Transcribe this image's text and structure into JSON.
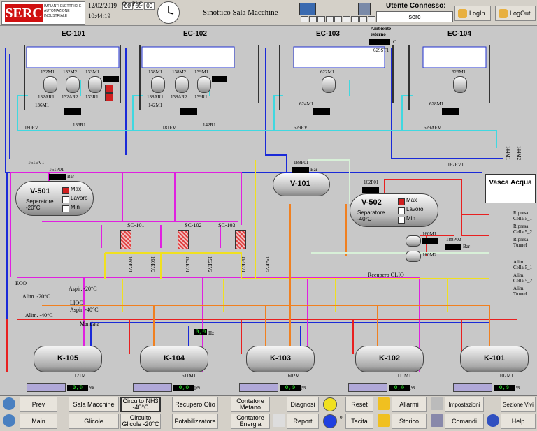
{
  "header": {
    "logo_text": "SERC",
    "logo_sub": "IMPIANTI ELETTRICI E AUTOMAZIONE INDUSTRIALE",
    "date": "12/02/2019",
    "time": "10:44:19",
    "plc_label": "Ora PLC",
    "plc_time": [
      "00",
      "00",
      "00"
    ],
    "title": "Sinottico Sala Macchine",
    "user_label": "Utente Connesso:",
    "user_value": "serc",
    "login_label": "LogIn",
    "logout_label": "LogOut"
  },
  "evaporators": [
    {
      "name": "EC-101",
      "motors": [
        "132M1",
        "132M2",
        "133M1"
      ],
      "ar": [
        "132AR1",
        "132AR2",
        "133R1"
      ],
      "fan": "136M1",
      "valve": "180EV",
      "r": "136R1"
    },
    {
      "name": "EC-102",
      "motors": [
        "138M1",
        "138M2",
        "139M1"
      ],
      "ar": [
        "138AR1",
        "138AR2",
        "139R1"
      ],
      "fan": "142M1",
      "valve": "181EV",
      "r": "142R1"
    },
    {
      "name": "EC-103",
      "motors": [
        "622M1"
      ],
      "fan": "624M1",
      "valve": "629EV"
    },
    {
      "name": "EC-104",
      "motors": [
        "626M1"
      ],
      "fan": "628M1",
      "valve": "629AEV"
    }
  ],
  "ambient": {
    "label": "Ambiente esterno",
    "unit": "C",
    "tag": "629ST1"
  },
  "vessels": {
    "v501": {
      "name": "V-501",
      "sub": "Separatore -20°C",
      "pt": "161P01",
      "ev": "161EV1",
      "unit": "Bar",
      "max": "Max",
      "lavoro": "Lavoro",
      "min": "Min"
    },
    "v101": {
      "name": "V-101",
      "pt": "188P01",
      "unit": "Bar"
    },
    "v502": {
      "name": "V-502",
      "sub": "Separatore -40°C",
      "pt": "162P01",
      "ev": "162EV1",
      "unit": "Bar",
      "max": "Max",
      "lavoro": "Lavoro",
      "min": "Min"
    }
  },
  "pumps": {
    "p1": "160M1",
    "p2": "160M2",
    "pt": "188P02",
    "unit": "Bar"
  },
  "coolers": [
    "SC-101",
    "SC-102",
    "SC-103"
  ],
  "valves_row": [
    "160EV1",
    "190EV2",
    "192EV1",
    "192EV2",
    "194EV1",
    "194EV2"
  ],
  "vasca": {
    "name": "Vasca Acqua",
    "m1": "144M1",
    "m2": "144M2"
  },
  "right_lines": [
    "Ripresa Cella 5_1",
    "Ripresa Cella 5_2",
    "Ripresa Tunnel",
    "Alim. Cella 5_1",
    "Alim. Cella 5_2",
    "Alim. Tunnel"
  ],
  "line_labels": {
    "eco": "ECO",
    "asp20": "Aspir. -20°C",
    "alim20": "Alim. -20°C",
    "lioc": "LIOC",
    "asp40": "Aspir. -40°C",
    "alim40": "Alim. -40°C",
    "mandata": "Mandata",
    "recupero": "Recupero OLIO"
  },
  "compressors": [
    {
      "name": "K-105",
      "pct": "0,0",
      "m": "121M1",
      "r": "122R1",
      "ev": "138EV1"
    },
    {
      "name": "K-104",
      "pct": "0,0",
      "m": "611M1",
      "r": "612R1",
      "ev": "138EV19",
      "hz": "0,0",
      "hz_unit": "Hz"
    },
    {
      "name": "K-103",
      "pct": "0,0",
      "m": "602M1",
      "r": "603R1",
      "ev": "138EV10"
    },
    {
      "name": "K-102",
      "pct": "0,0",
      "m": "111M1",
      "r": "112R1",
      "ev": "138EV11"
    },
    {
      "name": "K-101",
      "pct": "0,0",
      "m": "102M1",
      "r": "103R1",
      "ev": "138EV1"
    }
  ],
  "pct_unit": "%",
  "footer": {
    "prev": "Prev",
    "main": "Main",
    "sala": "Sala Macchine",
    "glicole": "Glicole",
    "circ_nh3": "Circuito NH3 -40°C",
    "circ_gl": "Circuito Glicole -20°C",
    "recupero": "Recupero Olio",
    "potab": "Potabilizzatore",
    "cont_met": "Contatore Metano",
    "cont_en": "Contatore Energia",
    "diagnosi": "Diagnosi",
    "report": "Report",
    "reset": "Reset",
    "tacita": "Tacita",
    "tacita_count": "0",
    "allarmi": "Allarmi",
    "storico": "Storico",
    "impost": "Impostazioni",
    "comandi": "Comandi",
    "sezione": "Sezione Vivi",
    "help": "Help"
  }
}
